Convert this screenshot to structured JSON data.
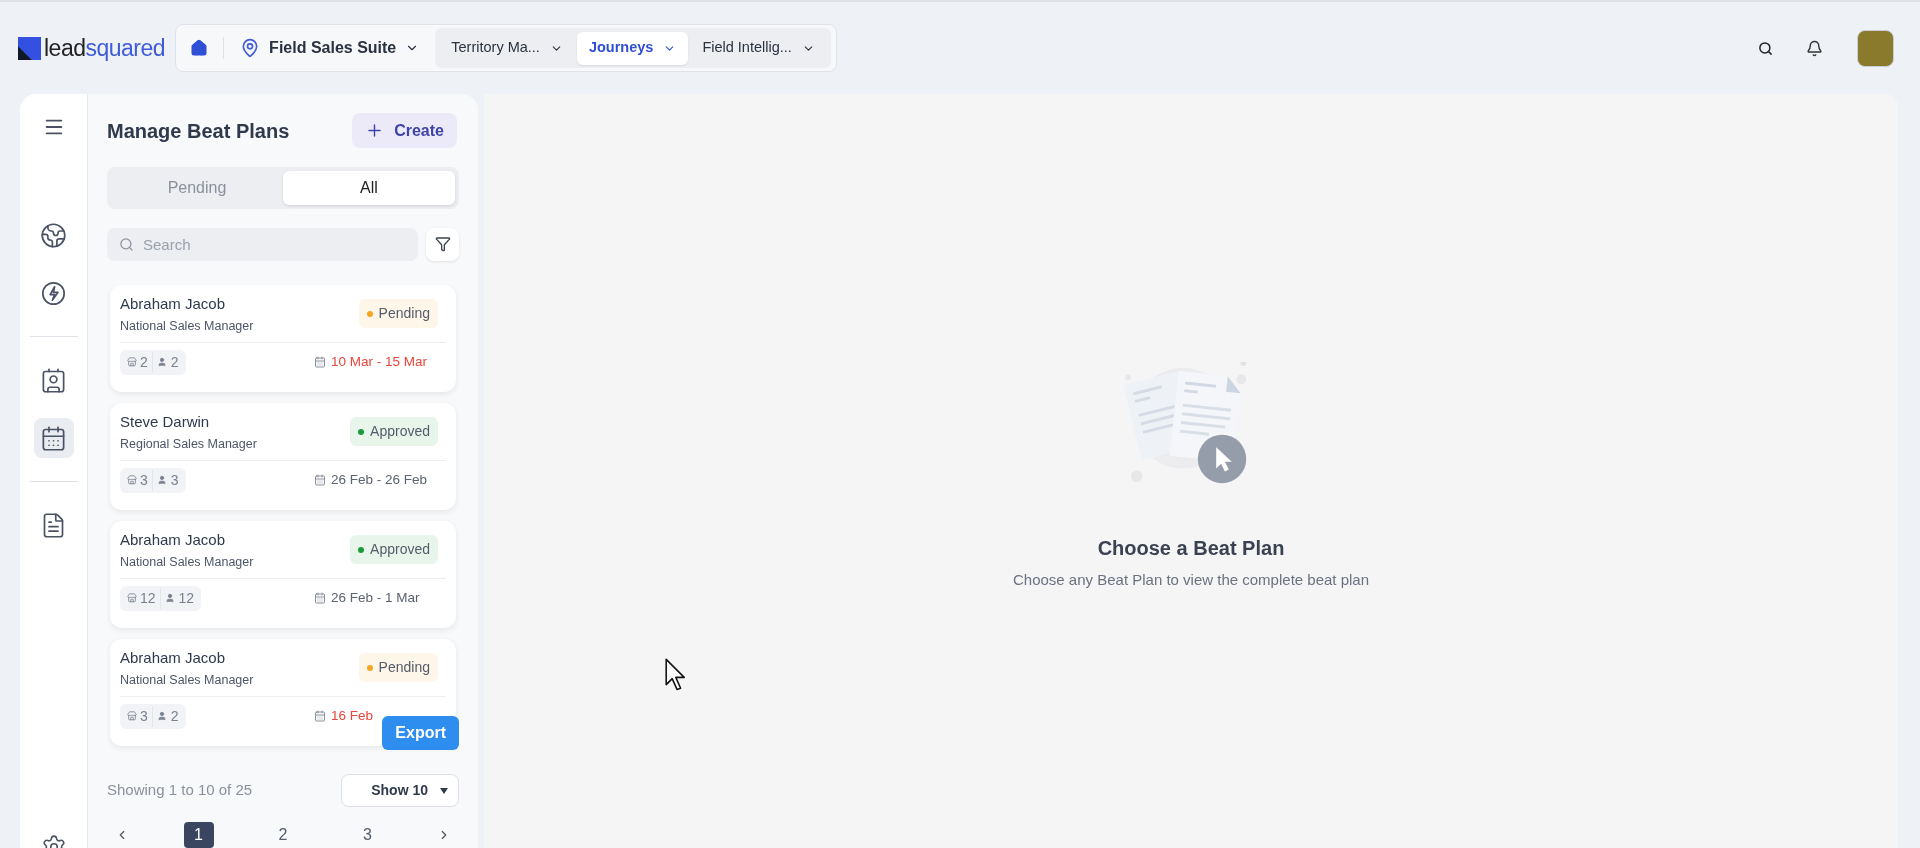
{
  "logo": {
    "text_parts": [
      "lead",
      "squared"
    ]
  },
  "nav": {
    "suite": "Field Sales Suite",
    "tabs": [
      {
        "label": "Territory Ma...",
        "selected": false
      },
      {
        "label": "Journeys",
        "selected": true
      },
      {
        "label": "Field Intellig...",
        "selected": false
      }
    ]
  },
  "sidebar": {
    "items": [
      {
        "kind": "globe",
        "selected": false
      },
      {
        "kind": "bolt",
        "selected": false
      },
      {
        "kind": "divider"
      },
      {
        "kind": "contacts",
        "selected": false
      },
      {
        "kind": "calendar",
        "selected": true
      },
      {
        "kind": "divider"
      },
      {
        "kind": "document",
        "selected": false
      }
    ]
  },
  "panel": {
    "title": "Manage Beat Plans",
    "create_button": "Create",
    "filter_tabs": [
      {
        "label": "Pending",
        "selected": false
      },
      {
        "label": "All",
        "selected": true
      }
    ],
    "search": {
      "placeholder": "Search"
    },
    "plans": [
      {
        "name": "Abraham Jacob",
        "role": "National Sales Manager",
        "status": "Pending",
        "color": "#f5a623",
        "outlets": "2",
        "users": "2",
        "dates": "10 Mar - 15 Mar",
        "overdue": true
      },
      {
        "name": "Steve Darwin",
        "role": "Regional Sales Manager",
        "status": "Approved",
        "color": "#1a9b3a",
        "outlets": "3",
        "users": "3",
        "dates": "26 Feb - 26 Feb",
        "overdue": false
      },
      {
        "name": "Abraham Jacob",
        "role": "National Sales Manager",
        "status": "Approved",
        "color": "#1a9b3a",
        "outlets": "12",
        "users": "12",
        "dates": "26 Feb - 1 Mar",
        "overdue": false
      },
      {
        "name": "Abraham Jacob",
        "role": "National Sales Manager",
        "status": "Pending",
        "color": "#f5a623",
        "outlets": "3",
        "users": "2",
        "dates": "16 Feb",
        "overdue": true
      }
    ],
    "export_button": "Export",
    "summary": "Showing 1 to 10 of 25",
    "page_size": "Show 10",
    "pages": [
      {
        "label": "1",
        "selected": true
      },
      {
        "label": "2",
        "selected": false
      },
      {
        "label": "3",
        "selected": false
      }
    ]
  },
  "empty_state": {
    "title": "Choose a Beat Plan",
    "message": "Choose any Beat Plan to view the complete beat plan"
  }
}
